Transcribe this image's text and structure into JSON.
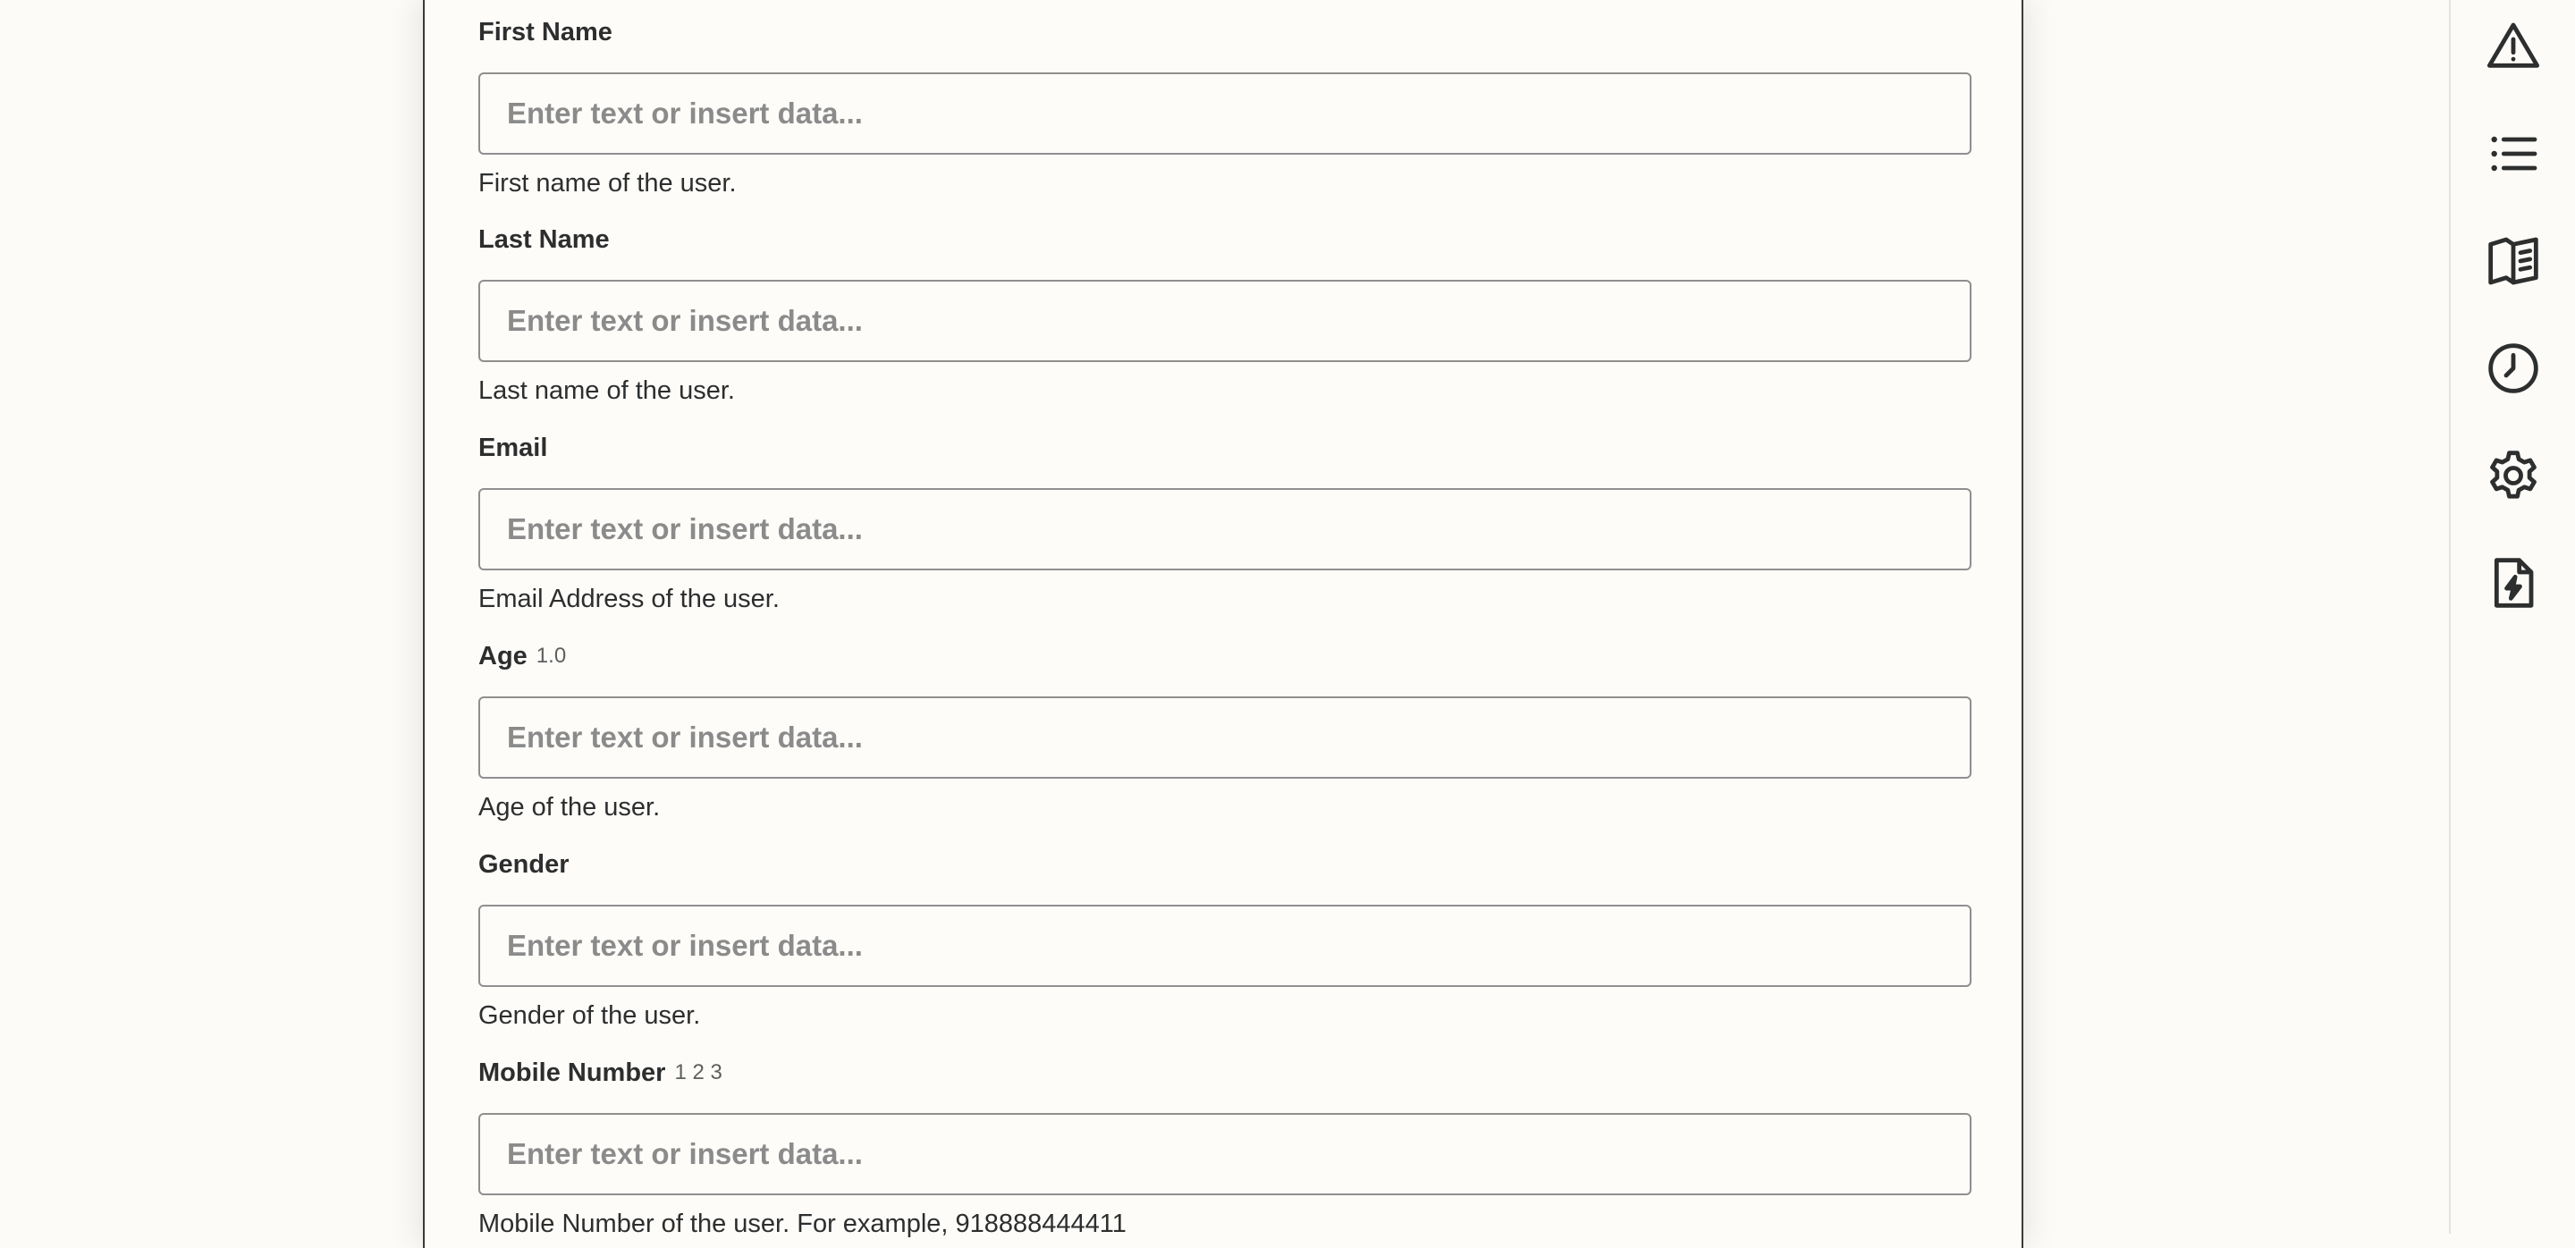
{
  "form": {
    "fields": [
      {
        "label": "First Name",
        "meta": "",
        "placeholder": "Enter text or insert data...",
        "help": "First name of the user."
      },
      {
        "label": "Last Name",
        "meta": "",
        "placeholder": "Enter text or insert data...",
        "help": "Last name of the user."
      },
      {
        "label": "Email",
        "meta": "",
        "placeholder": "Enter text or insert data...",
        "help": "Email Address of the user."
      },
      {
        "label": "Age",
        "meta": "1.0",
        "placeholder": "Enter text or insert data...",
        "help": "Age of the user."
      },
      {
        "label": "Gender",
        "meta": "",
        "placeholder": "Enter text or insert data...",
        "help": "Gender of the user."
      },
      {
        "label": "Mobile Number",
        "meta": "1 2 3",
        "placeholder": "Enter text or insert data...",
        "help": "Mobile Number of the user. For example, 918888444411"
      }
    ]
  },
  "sidebar": {
    "icons": [
      "warning-icon",
      "list-icon",
      "book-icon",
      "clock-icon",
      "gear-icon",
      "file-bolt-icon"
    ]
  }
}
